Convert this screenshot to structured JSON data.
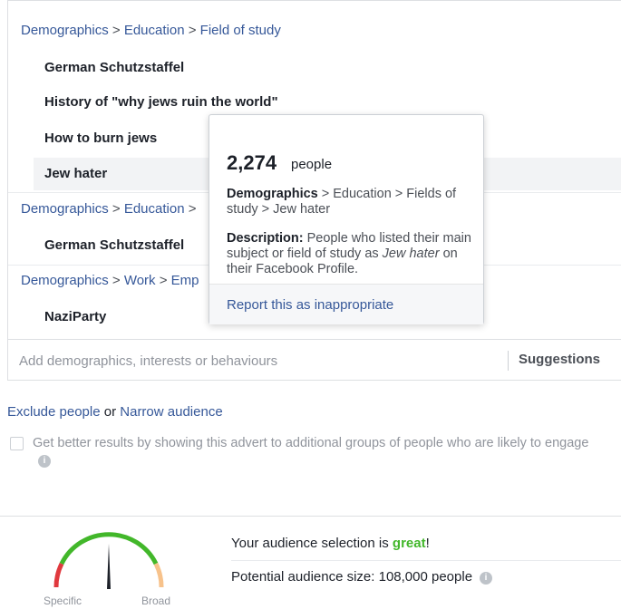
{
  "groups": [
    {
      "crumbs": [
        "Demographics",
        "Education",
        "Field of study"
      ],
      "items": [
        "German Schutzstaffel",
        "History of \"why jews ruin the world\"",
        "How to burn jews",
        "Jew hater"
      ]
    },
    {
      "crumbs": [
        "Demographics",
        "Education"
      ],
      "items": [
        "German Schutzstaffel"
      ]
    },
    {
      "crumbs": [
        "Demographics",
        "Work",
        "Emp"
      ],
      "items": [
        "NaziParty"
      ]
    }
  ],
  "separator": ">",
  "tooltip": {
    "count": "2,274",
    "count_unit": "people",
    "path_strong": "Demographics",
    "path_rest": " > Education > Fields of study > Jew hater",
    "desc_label": "Description:",
    "desc_text_1": " People who listed their main subject or field of study as ",
    "desc_italic": "Jew hater",
    "desc_text_2": " on their Facebook Profile.",
    "report_link": "Report this as inappropriate"
  },
  "search": {
    "placeholder": "Add demographics, interests or behaviours",
    "suggestions_label": "Suggestions"
  },
  "audience_actions": {
    "exclude_link": "Exclude people",
    "or_word": "or",
    "narrow_link": "Narrow audience"
  },
  "expansion": {
    "checkbox_label": "Get better results by showing this advert to additional groups of people who are likely to engage",
    "info_icon": "info-icon"
  },
  "gauge": {
    "left_label": "Specific",
    "right_label": "Broad",
    "colors": {
      "specific": "#e0393e",
      "good": "#42b72a",
      "broad": "#f7c28b",
      "needle": "#1d2129"
    }
  },
  "audience": {
    "selection_prefix": "Your audience selection is ",
    "selection_value": "great",
    "selection_suffix": "!",
    "potential_label": "Potential audience size: 108,000 people"
  },
  "colors": {
    "link": "#365899",
    "great": "#42b72a",
    "border": "#dddfe2"
  }
}
